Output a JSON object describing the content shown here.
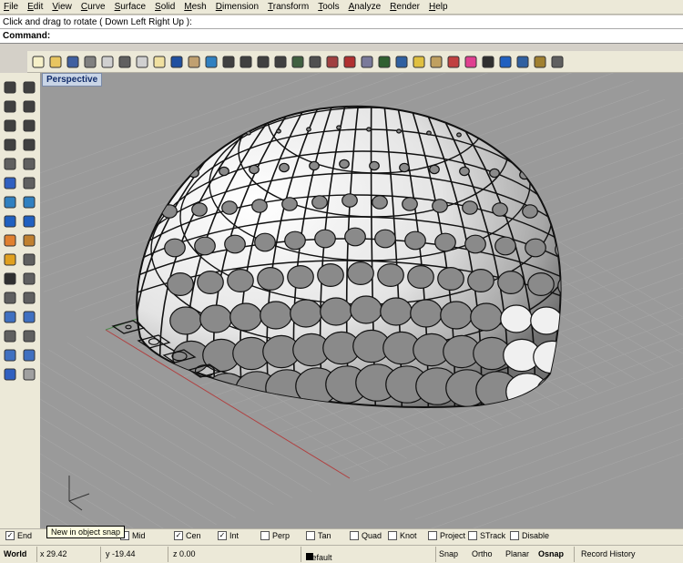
{
  "menu": [
    "File",
    "Edit",
    "View",
    "Curve",
    "Surface",
    "Solid",
    "Mesh",
    "Dimension",
    "Transform",
    "Tools",
    "Analyze",
    "Render",
    "Help"
  ],
  "command_history": "Click and drag to rotate ( Down  Left  Right  Up ):",
  "command": {
    "label": "Command:",
    "value": ""
  },
  "viewport": {
    "title": "Perspective"
  },
  "tooltip": "New in object snap",
  "osnaps": [
    {
      "label": "End",
      "checked": true
    },
    {
      "label": "Mid",
      "checked": false
    },
    {
      "label": "Cen",
      "checked": true
    },
    {
      "label": "Int",
      "checked": true
    },
    {
      "label": "Perp",
      "checked": false
    },
    {
      "label": "Tan",
      "checked": false
    },
    {
      "label": "Quad",
      "checked": false
    },
    {
      "label": "Knot",
      "checked": false
    },
    {
      "label": "Project",
      "checked": false
    },
    {
      "label": "STrack",
      "checked": false
    },
    {
      "label": "Disable",
      "checked": false
    }
  ],
  "status": {
    "cplane": "World",
    "x": "x 29.42",
    "y": "y -19.44",
    "z": "z 0.00",
    "layer": "Default",
    "snap": "Snap",
    "ortho": "Ortho",
    "planar": "Planar",
    "osnap": "Osnap",
    "history": "Record History"
  },
  "colors": {
    "ui": "#ece9d8",
    "viewport": "#9a9a9a",
    "tab": "#c9d5e6",
    "axis_x": "#b04040",
    "axis_y": "#4a8a4a"
  }
}
